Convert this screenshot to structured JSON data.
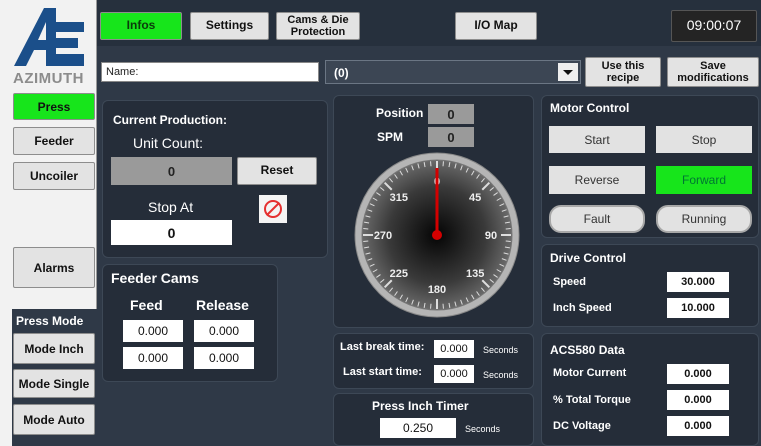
{
  "header": {
    "logo_text": "AZIMUTH",
    "tabs": [
      {
        "label": "Infos",
        "active": true
      },
      {
        "label": "Settings",
        "active": false
      },
      {
        "label": "Cams & Die Protection",
        "active": false
      },
      {
        "label": "I/O Map",
        "active": false
      }
    ],
    "clock": "09:00:07"
  },
  "recipe": {
    "name_label": "Name:",
    "name_value": "",
    "selected": "(0)",
    "use_button": "Use this recipe",
    "save_button": "Save modifications"
  },
  "sidebar": {
    "items": [
      {
        "label": "Press",
        "active": true
      },
      {
        "label": "Feeder",
        "active": false
      },
      {
        "label": "Uncoiler",
        "active": false
      },
      {
        "label": "Alarms",
        "active": false
      }
    ],
    "mode_title": "Press Mode",
    "modes": [
      "Mode Inch",
      "Mode Single",
      "Mode Auto"
    ]
  },
  "production": {
    "title": "Current Production:",
    "unit_count_label": "Unit Count:",
    "unit_count": "0",
    "reset_label": "Reset",
    "stop_at_label": "Stop At",
    "stop_at_value": "0"
  },
  "feeder_cams": {
    "title": "Feeder Cams",
    "feed_label": "Feed",
    "release_label": "Release",
    "feed_values": [
      "0.000",
      "0.000"
    ],
    "release_values": [
      "0.000",
      "0.000"
    ]
  },
  "dial": {
    "position_label": "Position",
    "position_value": "0",
    "spm_label": "SPM",
    "spm_value": "0",
    "angle_deg": 0,
    "ticks": [
      "0",
      "45",
      "90",
      "135",
      "180",
      "225",
      "270",
      "315"
    ]
  },
  "times": {
    "last_break_label": "Last break time:",
    "last_break_value": "0.000",
    "last_start_label": "Last start time:",
    "last_start_value": "0.000",
    "seconds": "Seconds"
  },
  "inch_timer": {
    "title": "Press Inch Timer",
    "value": "0.250",
    "unit": "Seconds"
  },
  "motor": {
    "title": "Motor Control",
    "start": "Start",
    "stop": "Stop",
    "reverse": "Reverse",
    "forward": "Forward",
    "fault": "Fault",
    "running": "Running"
  },
  "drive": {
    "title": "Drive Control",
    "speed_label": "Speed",
    "speed_value": "30.000",
    "inch_label": "Inch Speed",
    "inch_value": "10.000"
  },
  "acs": {
    "title": "ACS580 Data",
    "current_label": "Motor Current",
    "current_value": "0.000",
    "torque_label": "% Total Torque",
    "torque_value": "0.000",
    "dc_label": "DC Voltage",
    "dc_value": "0.000"
  },
  "colors": {
    "accent_green": "#17e51b",
    "background": "#2f3947",
    "needle": "#d40000"
  }
}
